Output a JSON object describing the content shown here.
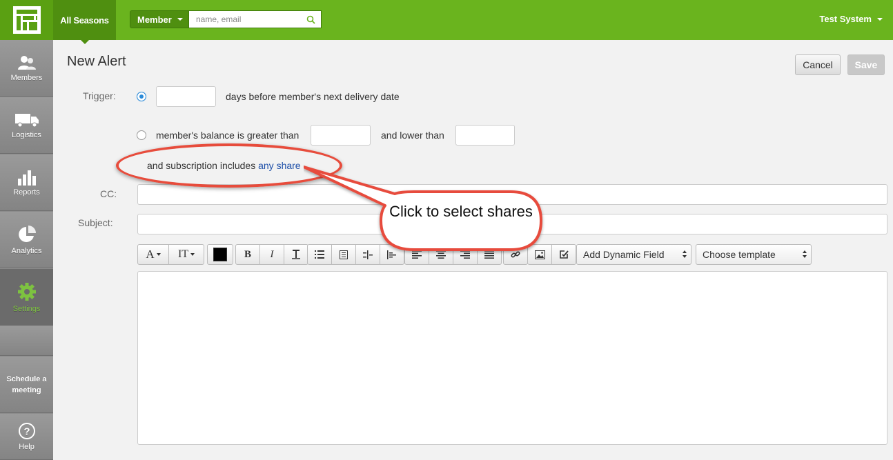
{
  "topbar": {
    "season_tab": "All Seasons",
    "member_dropdown": "Member",
    "search_placeholder": "name, email",
    "user_menu": "Test System"
  },
  "sidebar": {
    "items": [
      {
        "label": "Members",
        "icon": "members-icon"
      },
      {
        "label": "Logistics",
        "icon": "truck-icon"
      },
      {
        "label": "Reports",
        "icon": "bar-chart-icon"
      },
      {
        "label": "Analytics",
        "icon": "pie-chart-icon"
      },
      {
        "label": "Settings",
        "icon": "gear-icon",
        "active": true
      },
      {
        "label": "",
        "icon": ""
      },
      {
        "label": "Schedule a meeting",
        "icon": ""
      },
      {
        "label": "Help",
        "icon": "help-icon"
      }
    ]
  },
  "page": {
    "title": "New Alert",
    "cancel_label": "Cancel",
    "save_label": "Save"
  },
  "form": {
    "trigger_label": "Trigger:",
    "option1_text": "days before member's next delivery date",
    "option1_value": "",
    "option2_text": "member's balance is greater than",
    "option2_lower_text": "and lower than",
    "option2_greater_value": "",
    "option2_lower_value": "",
    "subscription_text": "and subscription includes",
    "subscription_link": "any share",
    "cc_label": "CC:",
    "cc_value": "",
    "subject_label": "Subject:",
    "subject_value": ""
  },
  "toolbar": {
    "font_button": "A",
    "font_size_button": "IT",
    "dynamic_field_select": "Add Dynamic Field",
    "template_select": "Choose template",
    "color_swatch": "#000000"
  },
  "annotation": {
    "callout_text": "Click to select shares",
    "highlight_color": "#e74c3c"
  },
  "colors": {
    "brand_green": "#6ab41e",
    "active_green": "#7dc240",
    "link_blue": "#1e4fa8"
  }
}
